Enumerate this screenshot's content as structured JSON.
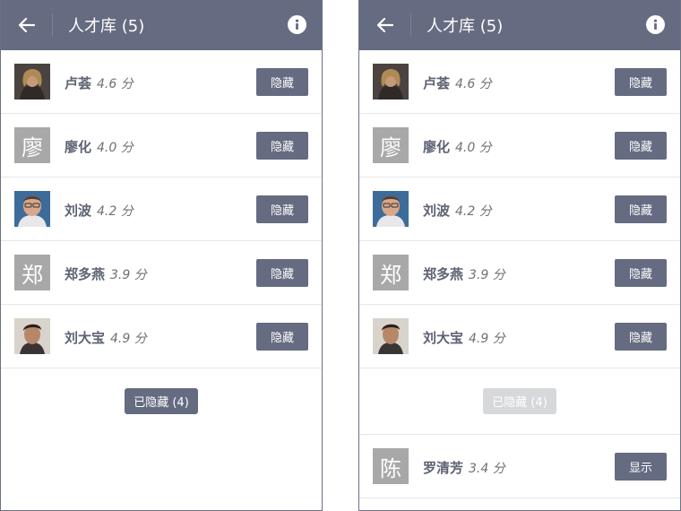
{
  "header": {
    "title": "人才库 (5)"
  },
  "candidates": [
    {
      "name": "卢荟",
      "score": "4.6 分",
      "avatar": "photo",
      "action": "隐藏"
    },
    {
      "name": "廖化",
      "score": "4.0 分",
      "avatar_text": "廖",
      "action": "隐藏"
    },
    {
      "name": "刘波",
      "score": "4.2 分",
      "avatar": "photo",
      "action": "隐藏"
    },
    {
      "name": "郑多燕",
      "score": "3.9 分",
      "avatar_text": "郑",
      "action": "隐藏"
    },
    {
      "name": "刘大宝",
      "score": "4.9 分",
      "avatar": "photo",
      "action": "隐藏"
    }
  ],
  "hidden_toggle": {
    "label": "已隐藏 (4)"
  },
  "hidden_candidates": [
    {
      "name": "罗清芳",
      "score": "3.4 分",
      "avatar_text": "陈",
      "action": "显示"
    }
  ],
  "colors": {
    "header_bg": "#656b80",
    "button_bg": "#656b80",
    "disabled_button_bg": "#d7d8dc"
  }
}
